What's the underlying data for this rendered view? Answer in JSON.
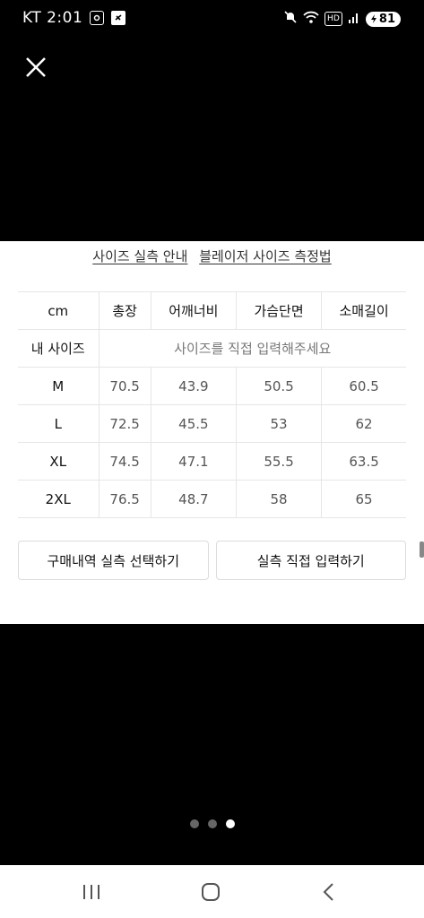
{
  "status_bar": {
    "carrier_time": "KT 2:01",
    "battery_level": "81",
    "icons": [
      "screen-capture-icon",
      "app-notification-icon",
      "mute-icon",
      "wifi-icon",
      "hd-voice-icon",
      "signal-icon",
      "battery-icon"
    ]
  },
  "guides": {
    "size_guide_link": "사이즈 실측 안내",
    "measure_guide_link": "블레이저 사이즈 측정법"
  },
  "table": {
    "headers": [
      "cm",
      "총장",
      "어깨너비",
      "가슴단면",
      "소매길이"
    ],
    "my_size_label": "내 사이즈",
    "my_size_placeholder": "사이즈를 직접 입력해주세요",
    "rows": [
      {
        "size": "M",
        "values": [
          "70.5",
          "43.9",
          "50.5",
          "60.5"
        ]
      },
      {
        "size": "L",
        "values": [
          "72.5",
          "45.5",
          "53",
          "62"
        ]
      },
      {
        "size": "XL",
        "values": [
          "74.5",
          "47.1",
          "55.5",
          "63.5"
        ]
      },
      {
        "size": "2XL",
        "values": [
          "76.5",
          "48.7",
          "58",
          "65"
        ]
      }
    ]
  },
  "buttons": {
    "purchase_history": "구매내역 실측 선택하기",
    "direct_input": "실측 직접 입력하기"
  },
  "pager": {
    "total": 3,
    "active": 3
  },
  "colors": {
    "background": "#000000",
    "sheet": "#ffffff",
    "border": "#e6e6e6"
  }
}
